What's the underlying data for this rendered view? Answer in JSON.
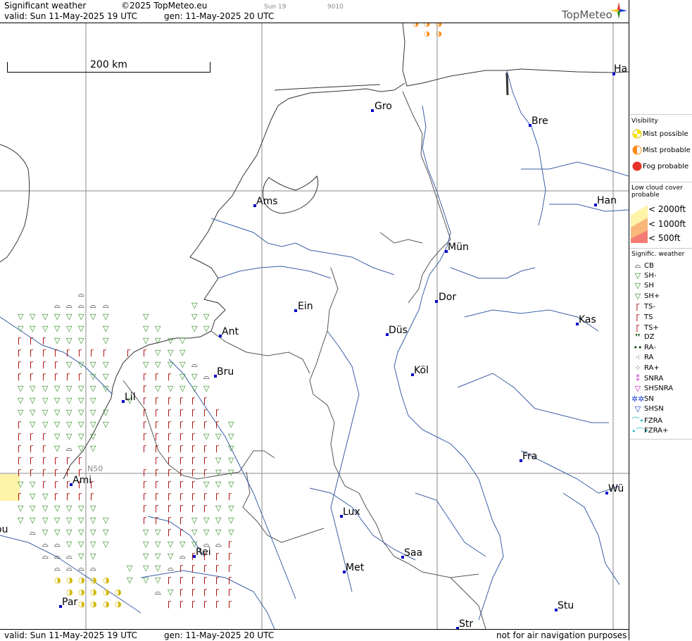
{
  "header": {
    "title": "Significant weather",
    "copyright": "©2025 TopMeteo.eu",
    "run": "Sun 19",
    "code": "9010",
    "valid": "valid:  Sun  11-May-2025  19 UTC",
    "generated": "gen: 11-May-2025 20 UTC",
    "logo": "TopMeteo"
  },
  "footer": {
    "valid": "valid:  Sun  11-May-2025  19 UTC",
    "generated": "gen: 11-May-2025 20 UTC",
    "disclaimer": "not for air navigation purposes"
  },
  "map": {
    "scale_label": "200 km",
    "lat_label": "N50",
    "cities": [
      {
        "name": "Ha"
      },
      {
        "name": "Gro"
      },
      {
        "name": "Bre"
      },
      {
        "name": "Han"
      },
      {
        "name": "Ams"
      },
      {
        "name": "Mün"
      },
      {
        "name": "Dor"
      },
      {
        "name": "Ein"
      },
      {
        "name": "Kas"
      },
      {
        "name": "Ant"
      },
      {
        "name": "Düs"
      },
      {
        "name": "Bru"
      },
      {
        "name": "Köl"
      },
      {
        "name": "Lil"
      },
      {
        "name": "Fra"
      },
      {
        "name": "Ami"
      },
      {
        "name": "Wü"
      },
      {
        "name": "Lux"
      },
      {
        "name": "Rei"
      },
      {
        "name": "Saa"
      },
      {
        "name": "Met"
      },
      {
        "name": "Stu"
      },
      {
        "name": "Par"
      },
      {
        "name": "Str"
      },
      {
        "name": "ou"
      }
    ]
  },
  "legend": {
    "visibility_title": "Visibility",
    "visibility": [
      {
        "label": "Mist possible",
        "color": "#f5e400"
      },
      {
        "label": "Mist probable",
        "color": "#ff8c1a"
      },
      {
        "label": "Fog probable",
        "color": "#e8322a"
      }
    ],
    "lowcloud_title": "Low cloud cover probable",
    "lowcloud": [
      {
        "label": "< 2000ft",
        "color": "#fff3a8"
      },
      {
        "label": "< 1000ft",
        "color": "#f9b77a"
      },
      {
        "label": "<   500ft",
        "color": "#f47c72"
      }
    ],
    "sigwx_title": "Signific. weather",
    "sigwx": [
      {
        "label": "CB",
        "icon": "cb-icon",
        "glyph": "⌓",
        "color": "#000"
      },
      {
        "label": "SH-",
        "icon": "shower-light-icon",
        "glyph": "▽",
        "color": "#2a8a1a"
      },
      {
        "label": "SH",
        "icon": "shower-icon",
        "glyph": "▽",
        "color": "#2a8a1a"
      },
      {
        "label": "SH+",
        "icon": "shower-heavy-icon",
        "glyph": "▽",
        "color": "#2a8a1a"
      },
      {
        "label": "TS-",
        "icon": "thunderstorm-light-icon",
        "glyph": "Ꞅ",
        "color": "#b01010"
      },
      {
        "label": "TS",
        "icon": "thunderstorm-icon",
        "glyph": "Ꞅ",
        "color": "#b01010"
      },
      {
        "label": "TS+",
        "icon": "thunderstorm-heavy-icon",
        "glyph": "Ꞅ",
        "color": "#b01010"
      },
      {
        "label": "DZ",
        "icon": "drizzle-icon",
        "glyph": "❜❜",
        "color": "#0a4a0a"
      },
      {
        "label": "RA-",
        "icon": "rain-light-icon",
        "glyph": "••",
        "color": "#0a4a0a"
      },
      {
        "label": "RA",
        "icon": "rain-icon",
        "glyph": "⁖",
        "color": "#0a4a0a"
      },
      {
        "label": "RA+",
        "icon": "rain-heavy-icon",
        "glyph": "⁘",
        "color": "#0a4a0a"
      },
      {
        "label": "SNRA",
        "icon": "snow-rain-icon",
        "glyph": "⁑",
        "color": "#c020c0"
      },
      {
        "label": "SHSNRA",
        "icon": "shower-snow-rain-icon",
        "glyph": "▽",
        "color": "#c020c0"
      },
      {
        "label": "SN",
        "icon": "snow-icon",
        "glyph": "✲✲",
        "color": "#1a3ad0"
      },
      {
        "label": "SHSN",
        "icon": "shower-snow-icon",
        "glyph": "▽",
        "color": "#1a3ad0"
      },
      {
        "label": "FZRA",
        "icon": "freezing-rain-icon",
        "glyph": "⌒•",
        "color": "#20c0d0"
      },
      {
        "label": "FZRA+",
        "icon": "freezing-rain-heavy-icon",
        "glyph": "•⌒•",
        "color": "#20c0d0"
      }
    ]
  }
}
